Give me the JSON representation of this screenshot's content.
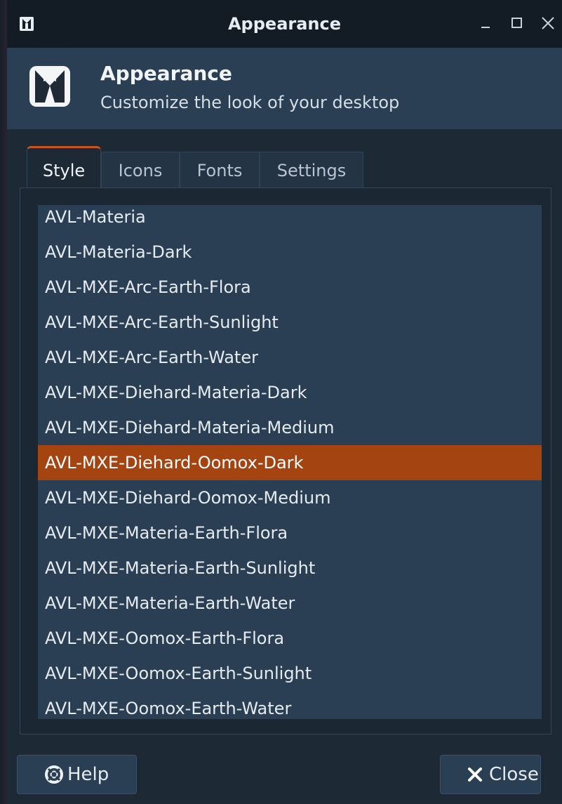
{
  "window": {
    "title": "Appearance",
    "controls": {
      "minimize_icon": "minimize-icon",
      "maximize_icon": "maximize-icon",
      "close_icon": "close-icon"
    }
  },
  "header": {
    "icon": "appearance-tuxedo-icon",
    "title": "Appearance",
    "subtitle": "Customize the look of your desktop"
  },
  "tabs": [
    {
      "label": "Style",
      "active": true
    },
    {
      "label": "Icons",
      "active": false
    },
    {
      "label": "Fonts",
      "active": false
    },
    {
      "label": "Settings",
      "active": false
    }
  ],
  "style_list": {
    "selected_index": 7,
    "items": [
      "AVL-Materia",
      "AVL-Materia-Dark",
      "AVL-MXE-Arc-Earth-Flora",
      "AVL-MXE-Arc-Earth-Sunlight",
      "AVL-MXE-Arc-Earth-Water",
      "AVL-MXE-Diehard-Materia-Dark",
      "AVL-MXE-Diehard-Materia-Medium",
      "AVL-MXE-Diehard-Oomox-Dark",
      "AVL-MXE-Diehard-Oomox-Medium",
      "AVL-MXE-Materia-Earth-Flora",
      "AVL-MXE-Materia-Earth-Sunlight",
      "AVL-MXE-Materia-Earth-Water",
      "AVL-MXE-Oomox-Earth-Flora",
      "AVL-MXE-Oomox-Earth-Sunlight",
      "AVL-MXE-Oomox-Earth-Water"
    ]
  },
  "buttons": {
    "help_label": "Help",
    "help_icon": "help-lifebuoy-icon",
    "close_label": "Close",
    "close_icon": "close-x-icon"
  },
  "colors": {
    "accent": "#c8561a",
    "selection": "#a34411",
    "header_bg": "#2a3e54",
    "window_bg": "#1d2935"
  }
}
